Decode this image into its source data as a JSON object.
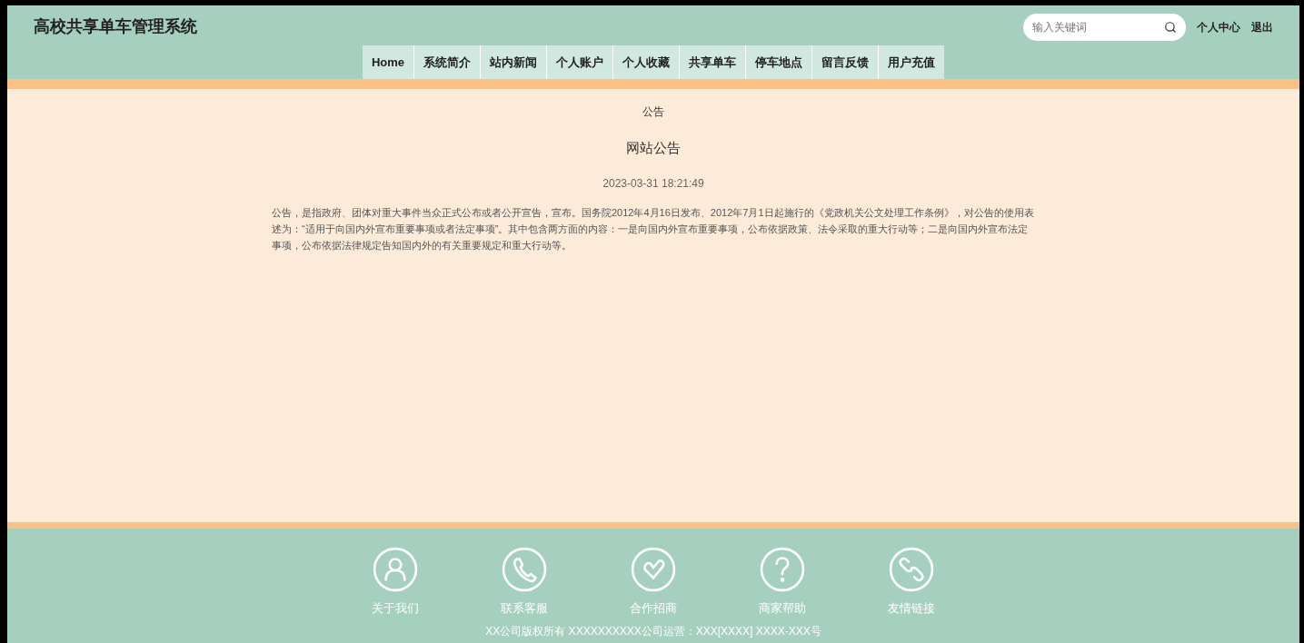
{
  "header": {
    "title": "高校共享单车管理系统",
    "search": {
      "placeholder": "输入关键词"
    },
    "links": [
      "个人中心",
      "退出"
    ]
  },
  "nav": [
    "Home",
    "系统简介",
    "站内新闻",
    "个人账户",
    "个人收藏",
    "共享单车",
    "停车地点",
    "留言反馈",
    "用户充值"
  ],
  "article": {
    "section": "公告",
    "title": "网站公告",
    "date": "2023-03-31 18:21:49",
    "body": "公告，是指政府、团体对重大事件当众正式公布或者公开宣告，宣布。国务院2012年4月16日发布、2012年7月1日起施行的《党政机关公文处理工作条例》，对公告的使用表述为：“适用于向国内外宣布重要事项或者法定事项”。其中包含两方面的内容：一是向国内外宣布重要事项，公布依据政策、法令采取的重大行动等；二是向国内外宣布法定事项，公布依据法律规定告知国内外的有关重要规定和重大行动等。"
  },
  "footer": {
    "items": [
      {
        "kind": "person",
        "label": "关于我们"
      },
      {
        "kind": "phone",
        "label": "联系客服"
      },
      {
        "kind": "heart",
        "label": "合作招商"
      },
      {
        "kind": "question",
        "label": "商家帮助"
      },
      {
        "kind": "link",
        "label": "友情链接"
      }
    ],
    "copyright": "XX公司版权所有 XXXXXXXXXX公司运营：XXX[XXXX] XXXX-XXX号"
  }
}
